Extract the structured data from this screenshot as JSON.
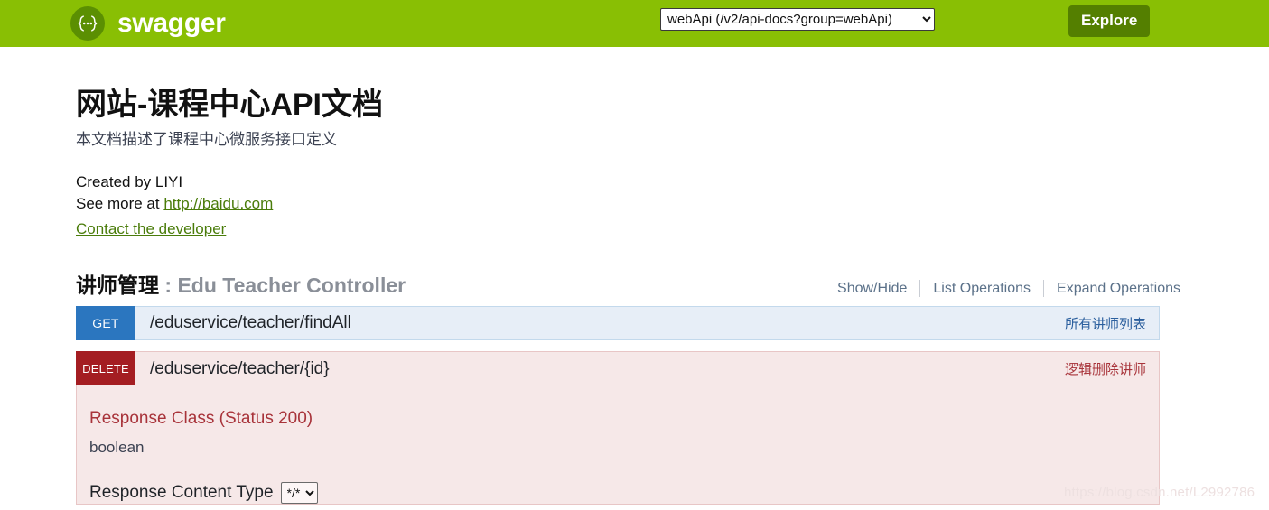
{
  "header": {
    "brand_name": "swagger",
    "logo_icon": "swagger-braces-icon",
    "api_selector_value": "webApi (/v2/api-docs?group=webApi)",
    "api_selector_options": [
      "webApi (/v2/api-docs?group=webApi)"
    ],
    "explore_label": "Explore",
    "bar_color": "#89bf04",
    "explore_color": "#547f00"
  },
  "doc": {
    "title": "网站-课程中心API文档",
    "subtitle": "本文档描述了课程中心微服务接口定义",
    "created_by": "Created by LIYI",
    "see_more_prefix": "See more at ",
    "see_more_link": "http://baidu.com",
    "contact_link": "Contact the developer",
    "link_color": "#4a7c0a"
  },
  "resource": {
    "title_cn": "讲师管理",
    "title_separator": " : ",
    "title_en": "Edu Teacher Controller",
    "options": [
      {
        "label": "Show/Hide"
      },
      {
        "label": "List Operations"
      },
      {
        "label": "Expand Operations"
      }
    ]
  },
  "operations": [
    {
      "method": "GET",
      "path": "/eduservice/teacher/findAll",
      "summary": "所有讲师列表",
      "expanded": false,
      "bg": "#e7eef7",
      "badge": "#2b76bf"
    },
    {
      "method": "DELETE",
      "path": "/eduservice/teacher/{id}",
      "summary": "逻辑删除讲师",
      "expanded": true,
      "bg": "#f6e8e8",
      "badge": "#a41d22"
    }
  ],
  "delete_details": {
    "response_class_title": "Response Class (Status 200)",
    "response_model": "boolean",
    "response_content_type_label": "Response Content Type",
    "response_content_type_value": "*/*",
    "response_content_type_options": [
      "*/*"
    ]
  },
  "watermark": {
    "text": "https://blog.csdn.net/L2992786"
  }
}
